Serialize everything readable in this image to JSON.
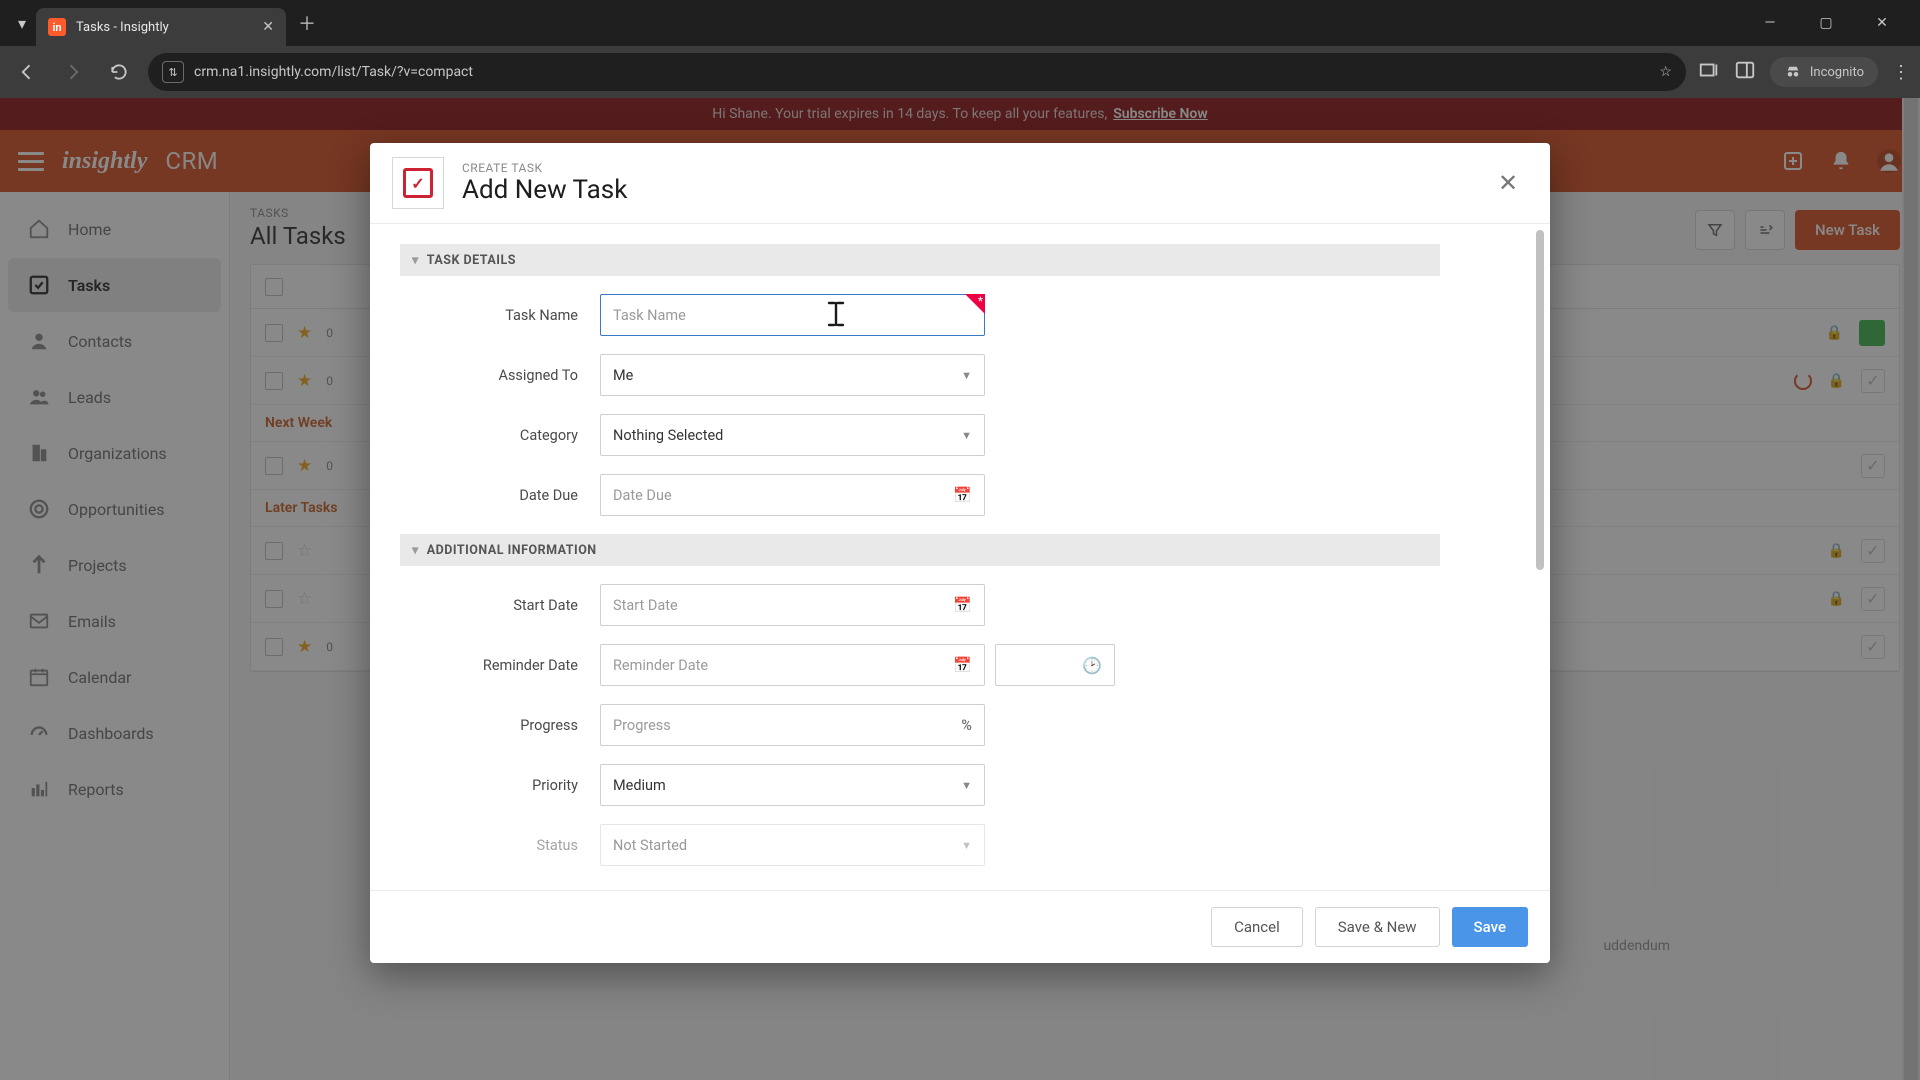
{
  "browser": {
    "tab_title": "Tasks - Insightly",
    "url": "crm.na1.insightly.com/list/Task/?v=compact",
    "incognito_label": "Incognito"
  },
  "banner": {
    "greeting": "Hi Shane. Your trial expires in 14 days. To keep all your features,",
    "cta": "Subscribe Now"
  },
  "header": {
    "brand": "insightly",
    "product": "CRM"
  },
  "sidebar": {
    "items": [
      {
        "label": "Home"
      },
      {
        "label": "Tasks"
      },
      {
        "label": "Contacts"
      },
      {
        "label": "Leads"
      },
      {
        "label": "Organizations"
      },
      {
        "label": "Opportunities"
      },
      {
        "label": "Projects"
      },
      {
        "label": "Emails"
      },
      {
        "label": "Calendar"
      },
      {
        "label": "Dashboards"
      },
      {
        "label": "Reports"
      }
    ]
  },
  "list": {
    "eyebrow": "TASKS",
    "title": "All Tasks",
    "new_task_btn": "New Task",
    "groups": {
      "next_week": "Next Week",
      "later": "Later Tasks"
    },
    "partial_text_a": "0",
    "partial_text_b": "0",
    "addendum_hint": "uddendum"
  },
  "modal": {
    "eyebrow": "CREATE TASK",
    "title": "Add New Task",
    "sections": {
      "details": "TASK DETAILS",
      "additional": "ADDITIONAL INFORMATION"
    },
    "fields": {
      "task_name": {
        "label": "Task Name",
        "placeholder": "Task Name",
        "value": ""
      },
      "assigned_to": {
        "label": "Assigned To",
        "value": "Me"
      },
      "category": {
        "label": "Category",
        "value": "Nothing Selected"
      },
      "date_due": {
        "label": "Date Due",
        "placeholder": "Date Due"
      },
      "start_date": {
        "label": "Start Date",
        "placeholder": "Start Date"
      },
      "reminder_date": {
        "label": "Reminder Date",
        "placeholder": "Reminder Date"
      },
      "progress": {
        "label": "Progress",
        "placeholder": "Progress"
      },
      "priority": {
        "label": "Priority",
        "value": "Medium"
      },
      "status": {
        "label": "Status",
        "value": "Not Started"
      }
    },
    "footer": {
      "cancel": "Cancel",
      "save_new": "Save & New",
      "save": "Save"
    }
  }
}
